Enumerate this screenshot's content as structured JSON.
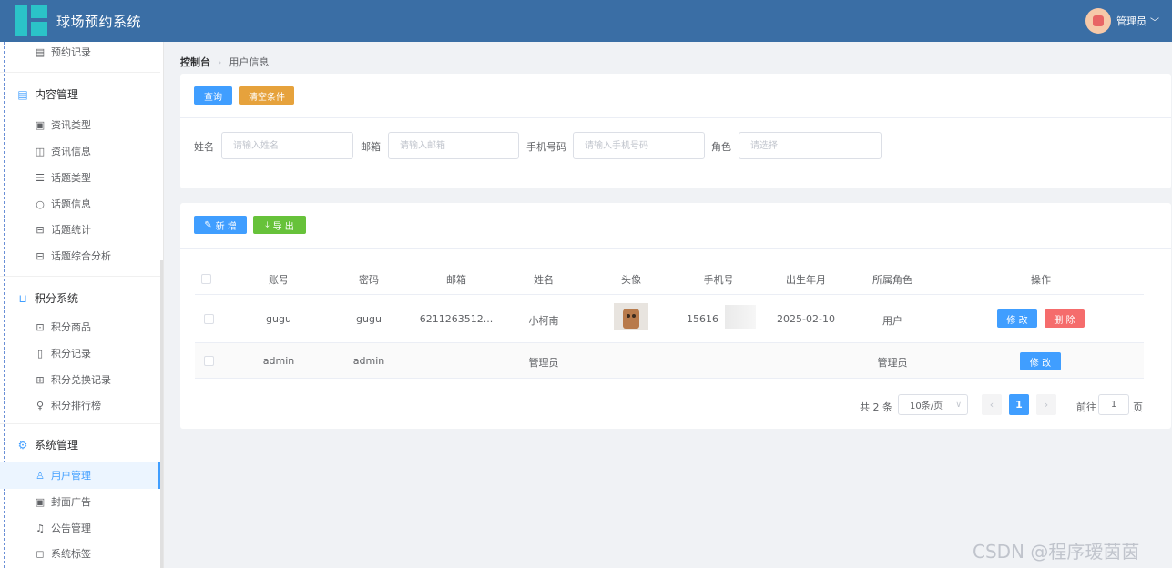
{
  "header": {
    "app_title": "球场预约系统",
    "user_label": "管理员",
    "chevron": "﹀"
  },
  "sidebar": {
    "top_item": {
      "label": "预约记录",
      "icon": "document-icon"
    },
    "groups": [
      {
        "title": "内容管理",
        "icon": "document-icon",
        "items": [
          {
            "label": "资讯类型",
            "icon": "notebook-icon"
          },
          {
            "label": "资讯信息",
            "icon": "document-add-icon"
          },
          {
            "label": "话题类型",
            "icon": "notes-icon"
          },
          {
            "label": "话题信息",
            "icon": "chat-icon"
          },
          {
            "label": "话题统计",
            "icon": "chart-board-icon"
          },
          {
            "label": "话题综合分析",
            "icon": "chart-board-icon"
          }
        ]
      },
      {
        "title": "积分系统",
        "icon": "cup-icon",
        "items": [
          {
            "label": "积分商品",
            "icon": "goods-icon"
          },
          {
            "label": "积分记录",
            "icon": "files-icon"
          },
          {
            "label": "积分兑换记录",
            "icon": "cart-icon"
          },
          {
            "label": "积分排行榜",
            "icon": "trophy-icon"
          }
        ]
      },
      {
        "title": "系统管理",
        "icon": "gear-icon",
        "items": [
          {
            "label": "用户管理",
            "icon": "user-icon"
          },
          {
            "label": "封面广告",
            "icon": "picture-icon"
          },
          {
            "label": "公告管理",
            "icon": "bell-icon"
          },
          {
            "label": "系统标签",
            "icon": "bookmark-icon"
          }
        ]
      }
    ]
  },
  "breadcrumb": {
    "home": "控制台",
    "sep": "›",
    "current": "用户信息"
  },
  "search": {
    "query_label": "查询",
    "clear_label": "清空条件",
    "name_label": "姓名",
    "name_placeholder": "请输入姓名",
    "email_label": "邮箱",
    "email_placeholder": "请输入邮箱",
    "phone_label": "手机号码",
    "phone_placeholder": "请输入手机号码",
    "role_label": "角色",
    "role_placeholder": "请选择"
  },
  "toolbar": {
    "add_label": "新 增",
    "export_label": "导 出",
    "add_icon": "✎",
    "export_icon": "⤓"
  },
  "table": {
    "columns": [
      "账号",
      "密码",
      "邮箱",
      "姓名",
      "头像",
      "手机号",
      "出生年月",
      "所属角色",
      "操作"
    ],
    "rows": [
      {
        "account": "gugu",
        "password": "gugu",
        "email": "6211263512...",
        "name": "小柯南",
        "phone": "15616",
        "birth": "2025-02-10",
        "role": "用户",
        "edit": "修 改",
        "delete": "删 除"
      },
      {
        "account": "admin",
        "password": "admin",
        "email": "",
        "name": "管理员",
        "phone": "",
        "birth": "",
        "role": "管理员",
        "edit": "修 改"
      }
    ]
  },
  "pagination": {
    "total": "共 2 条",
    "page_size": "10条/页",
    "prev": "‹",
    "current": "1",
    "next": "›",
    "goto_label": "前往",
    "goto_value": "1",
    "page_unit": "页"
  },
  "watermark": "CSDN @程序瑷茵茵"
}
